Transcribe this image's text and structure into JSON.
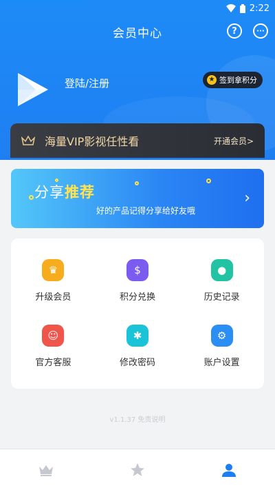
{
  "status": {
    "time": "2:22"
  },
  "header": {
    "title": "会员中心",
    "help_icon": "question-icon",
    "message_icon": "chat-icon"
  },
  "profile": {
    "login_label": "登陆/注册",
    "checkin_label": "签到拿积分"
  },
  "vip": {
    "text": "海量VIP影视任性看",
    "open_label": "开通会员>"
  },
  "share": {
    "title_plain": "分享",
    "title_highlight": "推荐",
    "subtitle": "好的产品记得分享给好友哦"
  },
  "grid": {
    "items": [
      {
        "label": "升级会员",
        "icon": "upgrade-icon",
        "color": "#f6ac1c"
      },
      {
        "label": "积分兑换",
        "icon": "points-bag-icon",
        "color": "#7b5cf0"
      },
      {
        "label": "历史记录",
        "icon": "history-footprint-icon",
        "color": "#22c3a3"
      },
      {
        "label": "官方客服",
        "icon": "customer-service-icon",
        "color": "#f0554b"
      },
      {
        "label": "修改密码",
        "icon": "password-icon",
        "color": "#1ac3d8"
      },
      {
        "label": "账户设置",
        "icon": "account-settings-icon",
        "color": "#2b8ef4"
      }
    ]
  },
  "footer": {
    "version": "v1.1.37 免责说明"
  },
  "tabbar": {
    "items": [
      "crown-icon",
      "star-icon",
      "user-icon"
    ],
    "active": "user-icon"
  },
  "colors": {
    "primary": "#1d8bf7",
    "accent_yellow": "#ffe44d",
    "vip_gold": "#f1d7a6"
  }
}
